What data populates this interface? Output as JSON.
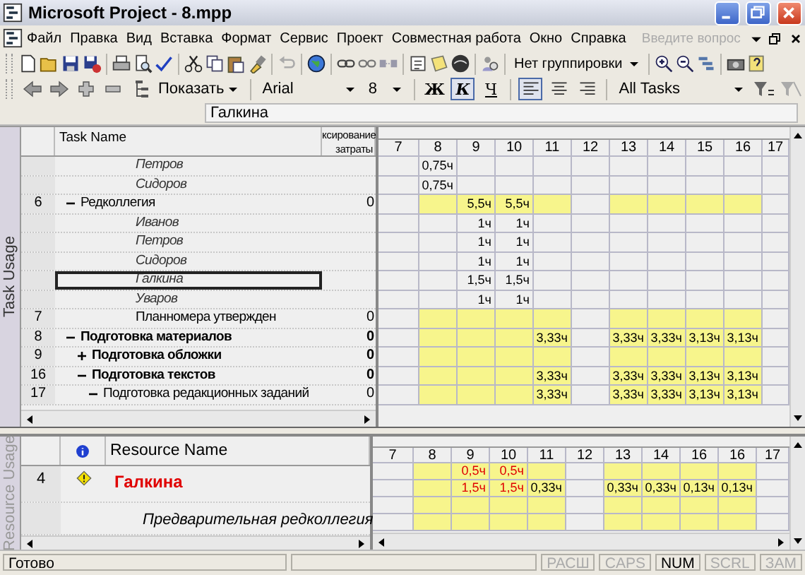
{
  "window": {
    "title": "Microsoft Project - 8.mpp"
  },
  "menu": {
    "items": [
      "Файл",
      "Правка",
      "Вид",
      "Вставка",
      "Формат",
      "Сервис",
      "Проект",
      "Совместная работа",
      "Окно",
      "Справка"
    ],
    "help_search": {
      "placeholder": "Введите вопрос"
    }
  },
  "standard_toolbar": {
    "grouping": "Нет группировки"
  },
  "formatting_toolbar": {
    "show_button": "Показать",
    "font": "Arial",
    "size": "8",
    "style_buttons": [
      {
        "label": "Ж",
        "pressed": false
      },
      {
        "label": "К",
        "pressed": true
      },
      {
        "label": "Ч",
        "pressed": false
      }
    ],
    "align_buttons": [
      {
        "kind": "left",
        "pressed": true
      },
      {
        "kind": "center",
        "pressed": false
      },
      {
        "kind": "right",
        "pressed": false
      }
    ],
    "filter": "All Tasks"
  },
  "entry_bar": {
    "value": "Галкина"
  },
  "task_usage": {
    "view_label": "Task Usage",
    "columns": [
      "Task Name",
      "ксирование затраты"
    ],
    "timescale": [
      "7",
      "8",
      "9",
      "10",
      "11",
      "12",
      "13",
      "14",
      "15",
      "16",
      "17"
    ],
    "rows": [
      {
        "kind": "assignment",
        "name": "Петров",
        "selected": false,
        "cells": [
          {
            "shaded": false
          },
          {
            "shaded": false,
            "text": "0,75ч"
          },
          {
            "shaded": false
          },
          {
            "shaded": false
          },
          {
            "shaded": false
          },
          {
            "shaded": false
          },
          {
            "shaded": false
          },
          {
            "shaded": false
          },
          {
            "shaded": false
          },
          {
            "shaded": false
          },
          {
            "shaded": false
          }
        ]
      },
      {
        "kind": "assignment",
        "name": "Сидоров",
        "selected": false,
        "cells": [
          {
            "shaded": false
          },
          {
            "shaded": false,
            "text": "0,75ч"
          },
          {
            "shaded": false
          },
          {
            "shaded": false
          },
          {
            "shaded": false
          },
          {
            "shaded": false
          },
          {
            "shaded": false
          },
          {
            "shaded": false
          },
          {
            "shaded": false
          },
          {
            "shaded": false
          },
          {
            "shaded": false
          }
        ]
      },
      {
        "kind": "task",
        "id": "6",
        "name": "Редколлегия",
        "cost": "0",
        "expanded": true,
        "selected": false,
        "cells": [
          {
            "shaded": false
          },
          {
            "shaded": true
          },
          {
            "shaded": true,
            "text": "5,5ч"
          },
          {
            "shaded": true,
            "text": "5,5ч"
          },
          {
            "shaded": true
          },
          {
            "shaded": false
          },
          {
            "shaded": true
          },
          {
            "shaded": true
          },
          {
            "shaded": true
          },
          {
            "shaded": true
          },
          {
            "shaded": false
          }
        ],
        "children": [
          {
            "kind": "assignment",
            "name": "Иванов",
            "selected": false,
            "cells": [
              {
                "shaded": false
              },
              {
                "shaded": false
              },
              {
                "shaded": false,
                "text": "1ч"
              },
              {
                "shaded": false,
                "text": "1ч"
              },
              {
                "shaded": false
              },
              {
                "shaded": false
              },
              {
                "shaded": false
              },
              {
                "shaded": false
              },
              {
                "shaded": false
              },
              {
                "shaded": false
              },
              {
                "shaded": false
              }
            ]
          },
          {
            "kind": "assignment",
            "name": "Петров",
            "selected": false,
            "cells": [
              {
                "shaded": false
              },
              {
                "shaded": false
              },
              {
                "shaded": false,
                "text": "1ч"
              },
              {
                "shaded": false,
                "text": "1ч"
              },
              {
                "shaded": false
              },
              {
                "shaded": false
              },
              {
                "shaded": false
              },
              {
                "shaded": false
              },
              {
                "shaded": false
              },
              {
                "shaded": false
              },
              {
                "shaded": false
              }
            ]
          },
          {
            "kind": "assignment",
            "name": "Сидоров",
            "selected": false,
            "cells": [
              {
                "shaded": false
              },
              {
                "shaded": false
              },
              {
                "shaded": false,
                "text": "1ч"
              },
              {
                "shaded": false,
                "text": "1ч"
              },
              {
                "shaded": false
              },
              {
                "shaded": false
              },
              {
                "shaded": false
              },
              {
                "shaded": false
              },
              {
                "shaded": false
              },
              {
                "shaded": false
              },
              {
                "shaded": false
              }
            ]
          },
          {
            "kind": "assignment",
            "name": "Галкина",
            "selected": true,
            "cells": [
              {
                "shaded": false
              },
              {
                "shaded": false
              },
              {
                "shaded": false,
                "text": "1,5ч"
              },
              {
                "shaded": false,
                "text": "1,5ч"
              },
              {
                "shaded": false
              },
              {
                "shaded": false
              },
              {
                "shaded": false
              },
              {
                "shaded": false
              },
              {
                "shaded": false
              },
              {
                "shaded": false
              },
              {
                "shaded": false
              }
            ]
          },
          {
            "kind": "assignment",
            "name": "Уваров",
            "selected": false,
            "cells": [
              {
                "shaded": false
              },
              {
                "shaded": false
              },
              {
                "shaded": false,
                "text": "1ч"
              },
              {
                "shaded": false,
                "text": "1ч"
              },
              {
                "shaded": false
              },
              {
                "shaded": false
              },
              {
                "shaded": false
              },
              {
                "shaded": false
              },
              {
                "shaded": false
              },
              {
                "shaded": false
              },
              {
                "shaded": false
              }
            ]
          }
        ]
      },
      {
        "kind": "task",
        "id": "7",
        "name": "Планномера утвержден",
        "cost": "0",
        "selected": false,
        "cells": [
          {
            "shaded": false
          },
          {
            "shaded": true
          },
          {
            "shaded": true
          },
          {
            "shaded": true
          },
          {
            "shaded": true
          },
          {
            "shaded": false
          },
          {
            "shaded": true
          },
          {
            "shaded": true
          },
          {
            "shaded": true
          },
          {
            "shaded": true
          },
          {
            "shaded": false
          }
        ]
      },
      {
        "kind": "summary",
        "id": "8",
        "name": "Подготовка материалов",
        "cost": "0",
        "expanded": true,
        "selected": false,
        "cells": [
          {
            "shaded": false
          },
          {
            "shaded": true
          },
          {
            "shaded": true
          },
          {
            "shaded": true
          },
          {
            "shaded": true,
            "text": "3,33ч"
          },
          {
            "shaded": false
          },
          {
            "shaded": true,
            "text": "3,33ч"
          },
          {
            "shaded": true,
            "text": "3,33ч"
          },
          {
            "shaded": true,
            "text": "3,13ч"
          },
          {
            "shaded": true,
            "text": "3,13ч"
          },
          {
            "shaded": false
          }
        ],
        "children": [
          {
            "kind": "summary",
            "id": "9",
            "name": "Подготовка обложки",
            "cost": "0",
            "expanded": false,
            "selected": false,
            "cells": [
              {
                "shaded": false
              },
              {
                "shaded": true
              },
              {
                "shaded": true
              },
              {
                "shaded": true
              },
              {
                "shaded": true
              },
              {
                "shaded": false
              },
              {
                "shaded": true
              },
              {
                "shaded": true
              },
              {
                "shaded": true
              },
              {
                "shaded": true
              },
              {
                "shaded": false
              }
            ]
          },
          {
            "kind": "summary",
            "id": "16",
            "name": "Подготовка текстов",
            "cost": "0",
            "expanded": true,
            "selected": false,
            "cells": [
              {
                "shaded": false
              },
              {
                "shaded": true
              },
              {
                "shaded": true
              },
              {
                "shaded": true
              },
              {
                "shaded": true,
                "text": "3,33ч"
              },
              {
                "shaded": false
              },
              {
                "shaded": true,
                "text": "3,33ч"
              },
              {
                "shaded": true,
                "text": "3,33ч"
              },
              {
                "shaded": true,
                "text": "3,13ч"
              },
              {
                "shaded": true,
                "text": "3,13ч"
              },
              {
                "shaded": false
              }
            ],
            "children": [
              {
                "kind": "task",
                "id": "17",
                "name": "Подготовка редакционных заданий",
                "cost": "0",
                "expanded": true,
                "selected": false,
                "cells": [
                  {
                    "shaded": false
                  },
                  {
                    "shaded": true
                  },
                  {
                    "shaded": true
                  },
                  {
                    "shaded": true
                  },
                  {
                    "shaded": true,
                    "text": "3,33ч"
                  },
                  {
                    "shaded": false
                  },
                  {
                    "shaded": true,
                    "text": "3,33ч"
                  },
                  {
                    "shaded": true,
                    "text": "3,33ч"
                  },
                  {
                    "shaded": true,
                    "text": "3,13ч"
                  },
                  {
                    "shaded": true,
                    "text": "3,13ч"
                  },
                  {
                    "shaded": false
                  }
                ]
              }
            ]
          }
        ]
      }
    ]
  },
  "resource_usage": {
    "view_label": "Resource Usage",
    "columns": [
      "Resource Name"
    ],
    "timescale": [
      "7",
      "8",
      "9",
      "10",
      "11",
      "12",
      "13",
      "14",
      "16",
      "16",
      "17"
    ],
    "rows": [
      {
        "kind": "resource",
        "id": "4",
        "name": "Галкина",
        "overallocated": true,
        "children": [
          {
            "kind": "assignment",
            "name": "Предварительная редколлегия"
          }
        ]
      }
    ],
    "grid_rows": [
      {
        "cells": [
          {
            "shaded": false
          },
          {
            "shaded": true
          },
          {
            "shaded": true,
            "text": "0,5ч",
            "overallocated": true
          },
          {
            "shaded": true,
            "text": "0,5ч",
            "overallocated": true
          },
          {
            "shaded": true
          },
          {
            "shaded": false
          },
          {
            "shaded": true
          },
          {
            "shaded": true
          },
          {
            "shaded": true
          },
          {
            "shaded": true
          },
          {
            "shaded": false
          }
        ]
      },
      {
        "cells": [
          {
            "shaded": false
          },
          {
            "shaded": true
          },
          {
            "shaded": true,
            "text": "1,5ч",
            "overallocated": true
          },
          {
            "shaded": true,
            "text": "1,5ч",
            "overallocated": true
          },
          {
            "shaded": true,
            "text": "0,33ч",
            "overallocated": false
          },
          {
            "shaded": false
          },
          {
            "shaded": true,
            "text": "0,33ч",
            "overallocated": false
          },
          {
            "shaded": true,
            "text": "0,33ч",
            "overallocated": false
          },
          {
            "shaded": true,
            "text": "0,13ч",
            "overallocated": false
          },
          {
            "shaded": true,
            "text": "0,13ч",
            "overallocated": false
          },
          {
            "shaded": false
          }
        ]
      },
      {
        "cells": [
          {
            "shaded": false
          },
          {
            "shaded": true
          },
          {
            "shaded": true
          },
          {
            "shaded": true
          },
          {
            "shaded": true
          },
          {
            "shaded": false
          },
          {
            "shaded": true
          },
          {
            "shaded": true
          },
          {
            "shaded": true
          },
          {
            "shaded": true
          },
          {
            "shaded": false
          }
        ]
      },
      {
        "cells": [
          {
            "shaded": false
          },
          {
            "shaded": true
          },
          {
            "shaded": true
          },
          {
            "shaded": true
          },
          {
            "shaded": true
          },
          {
            "shaded": false
          },
          {
            "shaded": true
          },
          {
            "shaded": true
          },
          {
            "shaded": true
          },
          {
            "shaded": true
          },
          {
            "shaded": false
          }
        ]
      }
    ]
  },
  "status_bar": {
    "text": "Готово",
    "indicators": [
      {
        "label": "РАСШ",
        "on": false
      },
      {
        "label": "CAPS",
        "on": false
      },
      {
        "label": "NUM",
        "on": true
      },
      {
        "label": "SCRL",
        "on": false
      },
      {
        "label": "ЗАМ",
        "on": false
      }
    ]
  }
}
